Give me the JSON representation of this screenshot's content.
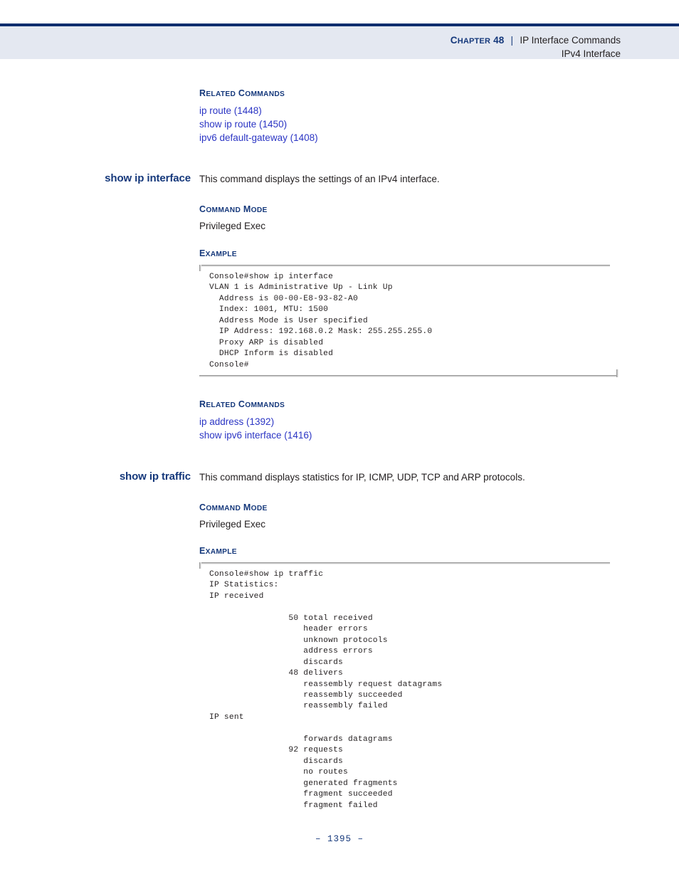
{
  "header": {
    "chapter_label": "CHAPTER 48",
    "chapter_word": "C",
    "chapter_rest": "HAPTER",
    "chapter_number": "48",
    "separator": "|",
    "title": "IP Interface Commands",
    "subtitle": "IPv4 Interface"
  },
  "footer": {
    "page_number": "–  1395  –"
  },
  "labels": {
    "related_commands": "RELATED COMMANDS",
    "command_mode": "COMMAND MODE",
    "example": "EXAMPLE",
    "privileged_exec": "Privileged Exec"
  },
  "related_commands_top": {
    "heading": "RELATED COMMANDS",
    "links": [
      "ip route (1448)",
      "show ip route (1450)",
      "ipv6 default-gateway (1408)"
    ]
  },
  "show_ip_interface": {
    "heading": "show ip interface",
    "description": "This command displays the settings of an IPv4 interface.",
    "command_mode_heading": "COMMAND MODE",
    "command_mode_value": "Privileged Exec",
    "example_heading": "EXAMPLE",
    "console_output": "Console#show ip interface\nVLAN 1 is Administrative Up - Link Up\n  Address is 00-00-E8-93-82-A0\n  Index: 1001, MTU: 1500\n  Address Mode is User specified\n  IP Address: 192.168.0.2 Mask: 255.255.255.0\n  Proxy ARP is disabled\n  DHCP Inform is disabled\nConsole#",
    "related_commands_heading": "RELATED COMMANDS",
    "related_links": [
      "ip address (1392)",
      "show ipv6 interface (1416)"
    ]
  },
  "show_ip_traffic": {
    "heading": "show ip traffic",
    "description": "This command displays statistics for IP, ICMP, UDP, TCP and ARP protocols.",
    "command_mode_heading": "COMMAND MODE",
    "command_mode_value": "Privileged Exec",
    "example_heading": "EXAMPLE",
    "console_output": "Console#show ip traffic\nIP Statistics:\nIP received\n\n                50 total received\n                   header errors\n                   unknown protocols\n                   address errors\n                   discards\n                48 delivers\n                   reassembly request datagrams\n                   reassembly succeeded\n                   reassembly failed\nIP sent\n\n                   forwards datagrams\n                92 requests\n                   discards\n                   no routes\n                   generated fragments\n                   fragment succeeded\n                   fragment failed",
    "statistics": {
      "command": "Console#show ip traffic",
      "section_title": "IP Statistics:",
      "ip_received_label": "IP received",
      "ip_received": [
        {
          "value": "50",
          "label": "total received"
        },
        {
          "value": "",
          "label": "header errors"
        },
        {
          "value": "",
          "label": "unknown protocols"
        },
        {
          "value": "",
          "label": "address errors"
        },
        {
          "value": "",
          "label": "discards"
        },
        {
          "value": "48",
          "label": "delivers"
        },
        {
          "value": "",
          "label": "reassembly request datagrams"
        },
        {
          "value": "",
          "label": "reassembly succeeded"
        },
        {
          "value": "",
          "label": "reassembly failed"
        }
      ],
      "ip_sent_label": "IP sent",
      "ip_sent": [
        {
          "value": "",
          "label": "forwards datagrams"
        },
        {
          "value": "92",
          "label": "requests"
        },
        {
          "value": "",
          "label": "discards"
        },
        {
          "value": "",
          "label": "no routes"
        },
        {
          "value": "",
          "label": "generated fragments"
        },
        {
          "value": "",
          "label": "fragment succeeded"
        },
        {
          "value": "",
          "label": "fragment failed"
        }
      ]
    }
  },
  "colors": {
    "header_band": "#e4e8f1",
    "header_rule": "#0b2d6e",
    "heading_blue": "#15387b",
    "link_blue": "#2b35c4",
    "body_text": "#231f20"
  }
}
